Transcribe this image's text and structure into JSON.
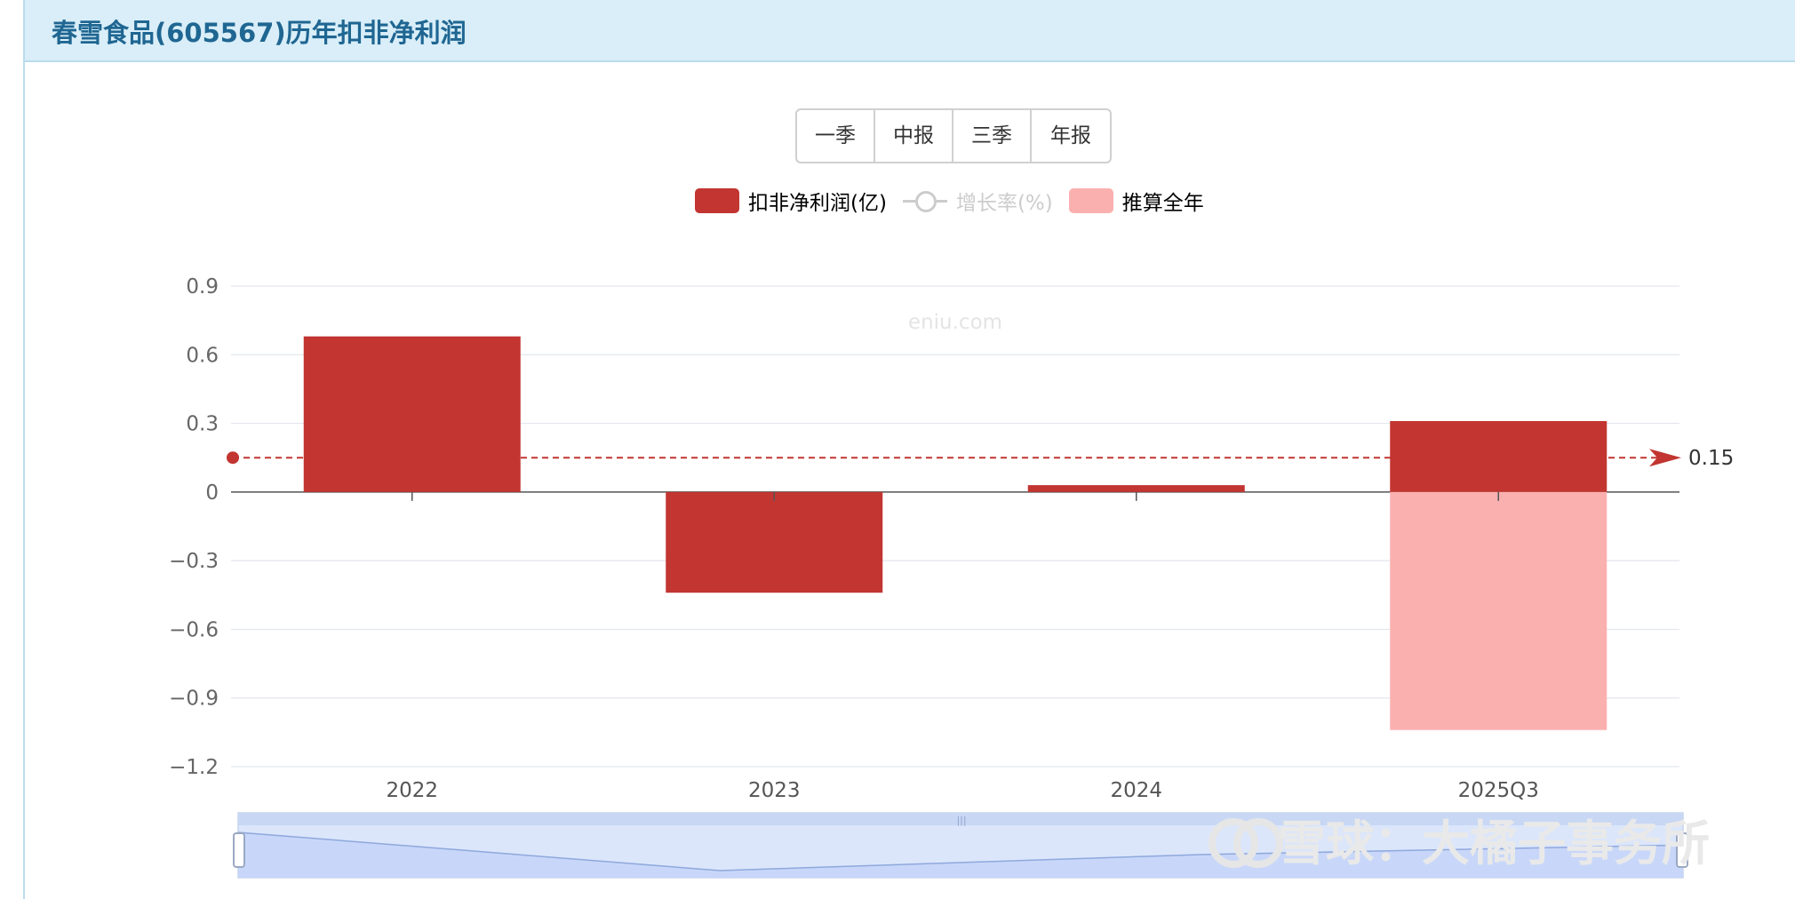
{
  "header": {
    "title": "春雪食品(605567)历年扣非净利润"
  },
  "tabs": [
    "一季",
    "中报",
    "三季",
    "年报"
  ],
  "legend": [
    {
      "label": "扣非净利润(亿)",
      "color": "#c23531",
      "kind": "bar",
      "active": true
    },
    {
      "label": "增长率(%)",
      "color": "#cccccc",
      "kind": "line",
      "active": false
    },
    {
      "label": "推算全年",
      "color": "#fbb0b0",
      "kind": "bar",
      "active": true
    }
  ],
  "watermark": "eniu.com",
  "chart_data": {
    "type": "bar",
    "categories": [
      "2022",
      "2023",
      "2024",
      "2025Q3"
    ],
    "series": [
      {
        "name": "扣非净利润(亿)",
        "values": [
          0.68,
          -0.44,
          0.03,
          0.31
        ],
        "color": "#c23531"
      },
      {
        "name": "推算全年",
        "values": [
          null,
          null,
          null,
          -1.04
        ],
        "color": "#fbb0b0"
      }
    ],
    "ylim": [
      -1.2,
      0.9
    ],
    "yticks": [
      0.9,
      0.6,
      0.3,
      0,
      -0.3,
      -0.6,
      -0.9,
      -1.2
    ],
    "ytick_labels": [
      "0.9",
      "0.6",
      "0.3",
      "0",
      "−0.3",
      "−0.6",
      "−0.9",
      "−1.2"
    ],
    "mark_line": {
      "value": 0.15,
      "label": "0.15",
      "color": "#c23531"
    },
    "grid": true,
    "legend_position": "top-center",
    "data_zoom": {
      "trend": [
        0.68,
        -0.44,
        0.03,
        0.31
      ]
    }
  },
  "overlay_watermark": "雪球：大橘子事务所"
}
